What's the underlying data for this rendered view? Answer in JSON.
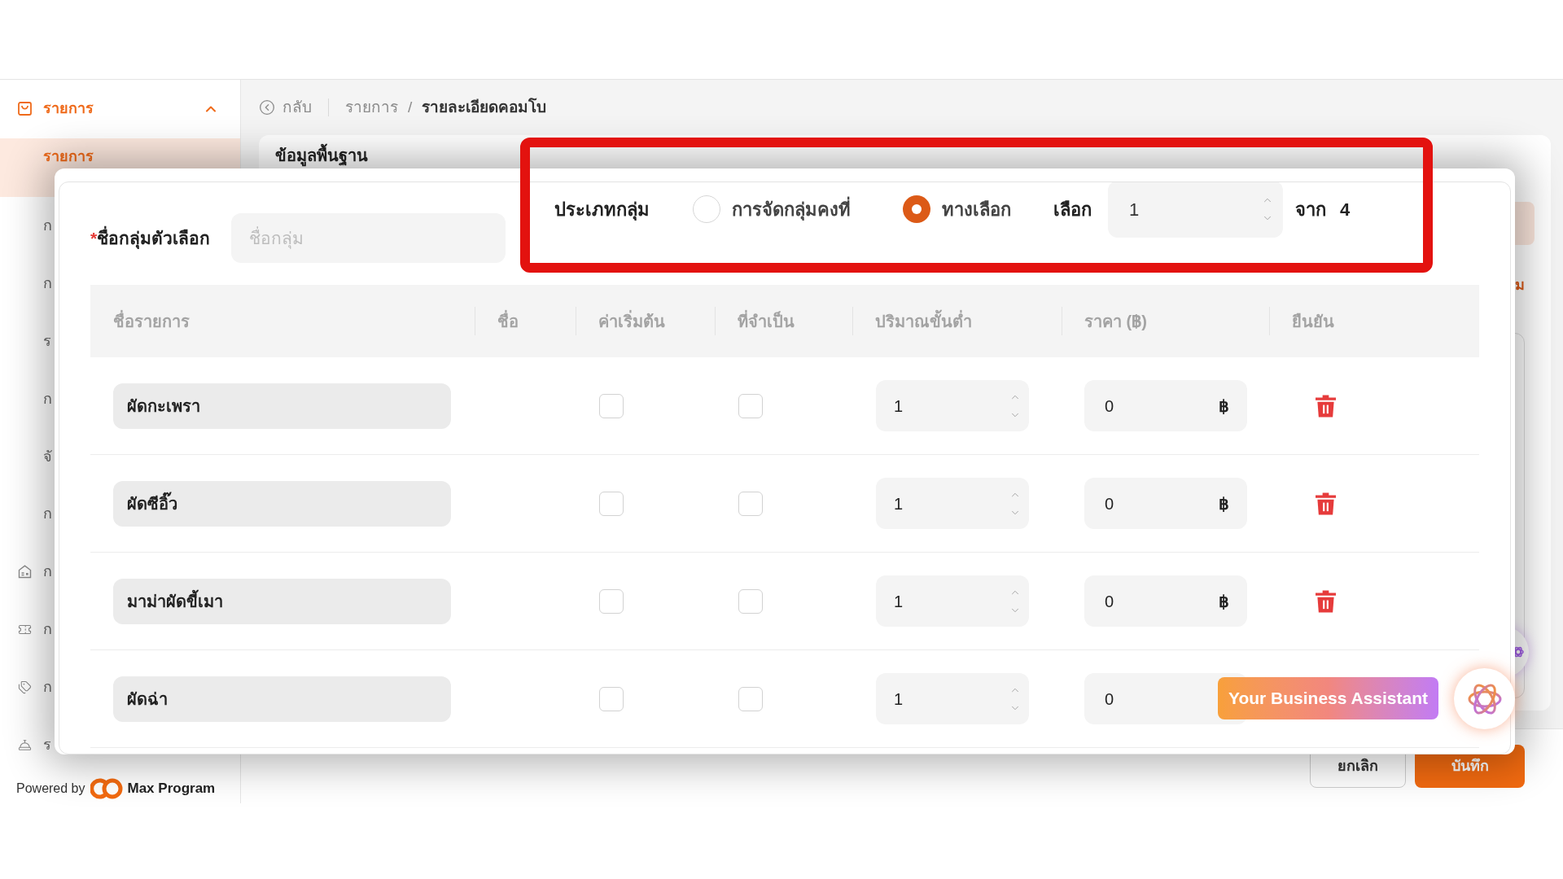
{
  "sidebar": {
    "section": {
      "label": "รายการ",
      "expanded": true
    },
    "items": [
      {
        "label": "รายการ",
        "selected": true,
        "kind": "text"
      },
      {
        "label": "ก",
        "selected": false,
        "kind": "text"
      },
      {
        "label": "ก",
        "selected": false,
        "kind": "text"
      },
      {
        "label": "ร",
        "selected": false,
        "kind": "text"
      },
      {
        "label": "ก",
        "selected": false,
        "kind": "text"
      },
      {
        "label": "จั",
        "selected": false,
        "kind": "text"
      },
      {
        "label": "ก",
        "selected": false,
        "kind": "text"
      },
      {
        "label": "ก",
        "selected": false,
        "kind": "icon"
      },
      {
        "label": "ก",
        "selected": false,
        "kind": "icon"
      },
      {
        "label": "ก",
        "selected": false,
        "kind": "icon"
      },
      {
        "label": "ร",
        "selected": false,
        "kind": "icon"
      }
    ],
    "footer": {
      "prefix": "Powered by",
      "brand": "Max Program"
    }
  },
  "breadcrumb": {
    "back": "กลับ",
    "separator": "/",
    "trail": [
      {
        "label": "รายการ",
        "current": false
      },
      {
        "label": "รายละเอียดคอมโบ",
        "current": true
      }
    ]
  },
  "page_card": {
    "title": "ข้อมูลพื้นฐาน",
    "side_text": "ม"
  },
  "page_actions": [
    {
      "label": "ยกเลิก",
      "kind": "secondary"
    },
    {
      "label": "บันทึก",
      "kind": "primary"
    }
  ],
  "modal": {
    "group_name": {
      "required_mark": "*",
      "label": "ชื่อกลุ่มตัวเลือก",
      "placeholder": "ชื่อกลุ่ม"
    },
    "group_type": {
      "label": "ประเภทกลุ่ม",
      "highlighted": true,
      "options": [
        {
          "label": "การจัดกลุ่มคงที่",
          "selected": false
        },
        {
          "label": "ทางเลือก",
          "selected": true
        }
      ],
      "pick_label": "เลือก",
      "pick_value": "1",
      "of_label": "จาก",
      "of_value": "4"
    },
    "table": {
      "columns": [
        "ชื่อรายการ",
        "ชื่อ",
        "ค่าเริ่มต้น",
        "ที่จำเป็น",
        "ปริมาณขั้นต่ำ",
        "ราคา (฿)",
        "ยืนยัน"
      ],
      "rows": [
        {
          "name": "ผัดกะเพรา",
          "default": false,
          "required": false,
          "min_qty": "1",
          "price": "0",
          "currency": "฿",
          "delete": true
        },
        {
          "name": "ผัดซีอิ๊ว",
          "default": false,
          "required": false,
          "min_qty": "1",
          "price": "0",
          "currency": "฿",
          "delete": true
        },
        {
          "name": "มาม่าผัดขี้เมา",
          "default": false,
          "required": false,
          "min_qty": "1",
          "price": "0",
          "currency": "฿",
          "delete": true
        },
        {
          "name": "ผัดฉ่า",
          "default": false,
          "required": false,
          "min_qty": "1",
          "price": "0",
          "delete": false
        }
      ]
    }
  },
  "assistant": {
    "label": "Your Business Assistant"
  }
}
